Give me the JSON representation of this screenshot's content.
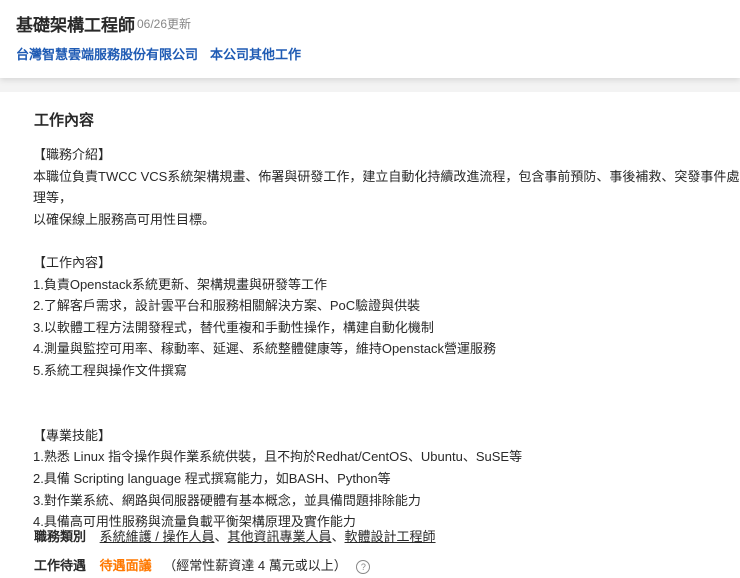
{
  "header": {
    "title": "基礎架構工程師",
    "updated": "06/26更新",
    "company": "台灣智慧雲端服務股份有限公司",
    "other_jobs": "本公司其他工作"
  },
  "content": {
    "heading": "工作內容",
    "description": "【職務介紹】\n本職位負責TWCC VCS系統架構規畫、佈署與研發工作，建立自動化持續改進流程，包含事前預防、事後補救、突發事件處理等，\n以確保線上服務高可用性目標。\n\n【工作內容】\n1.負責Openstack系統更新、架構規畫與研發等工作\n2.了解客戶需求，設計雲平台和服務相關解決方案、PoC驗證與供裝\n3.以軟體工程方法開發程式，替代重複和手動性操作，構建自動化機制\n4.測量與監控可用率、稼動率、延遲、系統整體健康等，維持Openstack營運服務\n5.系統工程與操作文件撰寫\n\n\n【專業技能】\n1.熟悉 Linux 指令操作與作業系統供裝，且不拘於Redhat/CentOS、Ubuntu、SuSE等\n2.具備 Scripting language 程式撰寫能力，如BASH、Python等\n3.對作業系統、網路與伺服器硬體有基本概念，並具備問題排除能力\n4.具備高可用性服務與流量負載平衡架構原理及實作能力",
    "category_label": "職務類別",
    "categories": [
      "系統維護 / 操作人員",
      "其他資訊專業人員",
      "軟體設計工程師"
    ],
    "separator": "、",
    "salary_label": "工作待遇",
    "salary": "待遇面議",
    "salary_note": "（經常性薪資達 4 萬元或以上）",
    "help_glyph": "?"
  }
}
